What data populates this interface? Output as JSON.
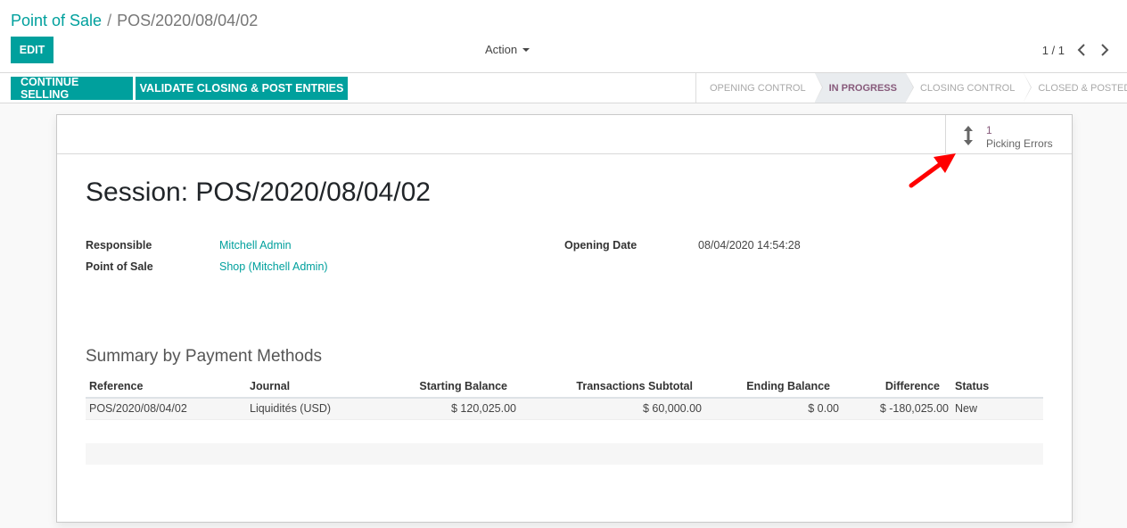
{
  "breadcrumb": {
    "parent": "Point of Sale",
    "separator": "/",
    "current": "POS/2020/08/04/02"
  },
  "toolbar": {
    "edit_label": "EDIT",
    "action_label": "Action"
  },
  "pager": {
    "value": "1 / 1"
  },
  "statusbar": {
    "continue_label": "CONTINUE SELLING",
    "validate_label": "VALIDATE CLOSING & POST ENTRIES",
    "stages": [
      "OPENING CONTROL",
      "IN PROGRESS",
      "CLOSING CONTROL",
      "CLOSED & POSTED"
    ],
    "active_stage": "IN PROGRESS"
  },
  "smart_button": {
    "count": "1",
    "label": "Picking Errors",
    "icon": "arrows-v-icon"
  },
  "form": {
    "title": "Session: POS/2020/08/04/02",
    "responsible_label": "Responsible",
    "responsible_value": "Mitchell Admin",
    "pos_label": "Point of Sale",
    "pos_value": "Shop (Mitchell Admin)",
    "opening_label": "Opening Date",
    "opening_value": "08/04/2020 14:54:28"
  },
  "summary": {
    "title": "Summary by Payment Methods",
    "columns": [
      "Reference",
      "Journal",
      "Starting Balance",
      "Transactions Subtotal",
      "Ending Balance",
      "Difference",
      "Status"
    ],
    "rows": [
      [
        "POS/2020/08/04/02",
        "Liquidités (USD)",
        "$ 120,025.00",
        "$ 60,000.00",
        "$ 0.00",
        "$ -180,025.00",
        "New"
      ]
    ]
  },
  "colors": {
    "primary": "#00A09D",
    "accent": "#875A7B",
    "annotation": "#ff0000"
  }
}
